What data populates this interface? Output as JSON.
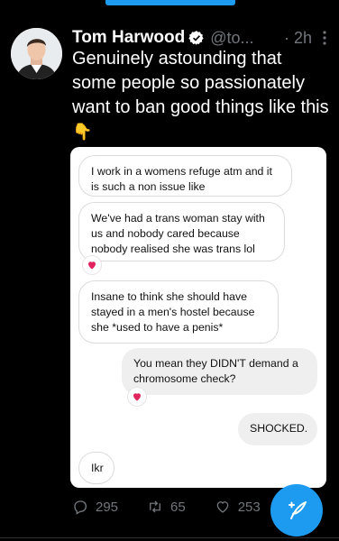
{
  "tweet": {
    "author_name": "Tom Harwood",
    "handle": "@to...",
    "time": "· 2h",
    "text": "Genuinely astounding that some people so passionately want to ban good things like this",
    "emoji": "👇"
  },
  "chat": {
    "messages": [
      {
        "side": "received",
        "text": "I work in a womens refuge atm and it is such a non issue like",
        "reaction": false
      },
      {
        "side": "received",
        "text": "We've had a trans woman stay with us and nobody cared because nobody realised she was trans lol",
        "reaction": true
      },
      {
        "side": "received",
        "text": "Insane to think she should have stayed in a men's hostel because she *used to have a penis*",
        "reaction": false
      },
      {
        "side": "sent",
        "text": "You mean they DIDN'T demand a chromosome check?",
        "reaction": true
      },
      {
        "side": "sent",
        "text": "SHOCKED.",
        "reaction": false
      },
      {
        "side": "received",
        "text": "Ikr",
        "reaction": false
      }
    ]
  },
  "actions": {
    "replies": "295",
    "retweets": "65",
    "likes": "253"
  },
  "colors": {
    "accent": "#1d9bf0",
    "background": "#000000",
    "heart": "#e0245e"
  }
}
